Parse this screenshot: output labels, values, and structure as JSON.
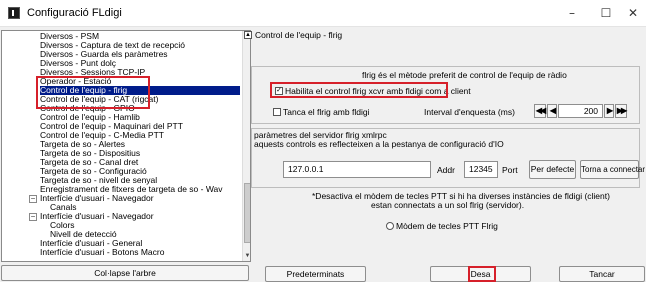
{
  "window": {
    "title": "Configuració FLdigi",
    "minimize": "–",
    "maximize": "☐",
    "close": "✕"
  },
  "tree": {
    "items": [
      {
        "label": "Diversos - PSM"
      },
      {
        "label": "Diversos - Captura de text de recepció"
      },
      {
        "label": "Diversos - Guarda els paràmetres"
      },
      {
        "label": "Diversos - Punt dolç"
      },
      {
        "label": "Diversos - Sessions TCP-IP"
      },
      {
        "label": "Operador - Estació"
      },
      {
        "label": "Control de l'equip - flrig"
      },
      {
        "label": "Control de l'equip - CAT (rigcat)"
      },
      {
        "label": "Control de l'equip - GPIO"
      },
      {
        "label": "Control de l'equip - Hamlib"
      },
      {
        "label": "Control de l'equip - Maquinari del PTT"
      },
      {
        "label": "Control de l'equip - C-Media PTT"
      },
      {
        "label": "Targeta de so - Alertes"
      },
      {
        "label": "Targeta de so - Dispositius"
      },
      {
        "label": "Targeta de so - Canal dret"
      },
      {
        "label": "Targeta de so - Configuració"
      },
      {
        "label": "Targeta de so - nivell de senyal"
      },
      {
        "label": "Enregistrament de fitxers de targeta de so - Wav"
      },
      {
        "label": "Interfície d'usuari - Navegador",
        "toggle": "−"
      },
      {
        "label": "Canals"
      },
      {
        "label": "Interfície d'usuari - Navegador",
        "toggle": "−"
      },
      {
        "label": "Colors"
      },
      {
        "label": "Nivell de detecció"
      },
      {
        "label": "Interfície d'usuari - General"
      },
      {
        "label": "Interfície d'usuari - Botons Macro"
      }
    ],
    "selected_index": 6
  },
  "right": {
    "header": "Control de l'equip - flrig",
    "intro": "flrig és el mètode preferit de control de l'equip de ràdio",
    "enable_checkbox": "Habilita el control flrig xcvr amb fldigi com a client",
    "tranca_checkbox": "Tanca el flrig amb fldigi",
    "poll_label": "Interval d'enquesta (ms)",
    "poll_value": "200",
    "xmlrpc_title": "paràmetres del servidor flrig xmlrpc",
    "xmlrpc_note": "aquests controls es reflecteixen a la pestanya de configuració d'IO",
    "addr_value": "127.0.0.1",
    "addr_label": "Addr",
    "port_value": "12345",
    "port_label": "Port",
    "defaults_button": "Per defecte",
    "reconnect_button": "Torna a connectar",
    "warning_line1": "*Desactiva el mòdem de tecles PTT si hi ha diverses instàncies de fldigi (client)",
    "warning_line2": "estan connectats a un sol flrig (servidor).",
    "ptt_radio": "Mòdem de tecles PTT Flrig"
  },
  "bottom": {
    "collapse_button": "Col·lapse l'arbre",
    "defaults_button": "Predeterminats",
    "save_button": "Desa",
    "close_button": "Tancar"
  },
  "spin_symbols": {
    "fast_back": "◀◀",
    "back": "◀",
    "fwd": "▶",
    "fast_fwd": "▶▶"
  },
  "colors": {
    "selection": "#001c8a",
    "highlight_box": "#d6202a"
  }
}
